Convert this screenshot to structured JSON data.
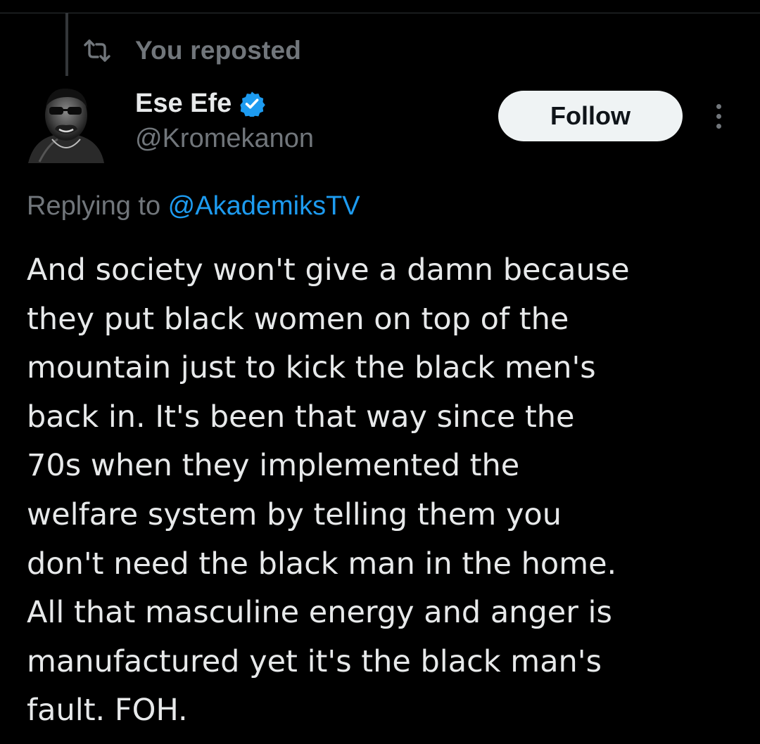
{
  "repost": {
    "label": "You reposted",
    "icon": "repost-icon"
  },
  "author": {
    "display_name": "Ese Efe",
    "handle": "@Kromekanon",
    "verified": true,
    "verified_icon": "verified-badge-icon",
    "verified_color": "#1d9bf0"
  },
  "actions": {
    "follow_label": "Follow",
    "more_icon": "more-vertical-icon"
  },
  "reply": {
    "prefix": "Replying to ",
    "mention": "@AkademiksTV"
  },
  "tweet": {
    "lines": [
      "And society won't give a damn because",
      "they put black women on top of the",
      "mountain just to kick the black men's",
      "back in. It's been that way since the",
      "70s when they implemented the",
      "welfare system by telling them you",
      "don't need the black man in the home.",
      "All that masculine energy and anger is",
      "manufactured yet it's the black man's",
      "fault. FOH."
    ]
  },
  "colors": {
    "background": "#000000",
    "text": "#e7e9ea",
    "secondary_text": "#71767b",
    "link": "#1d9bf0",
    "follow_bg": "#eff3f4"
  }
}
